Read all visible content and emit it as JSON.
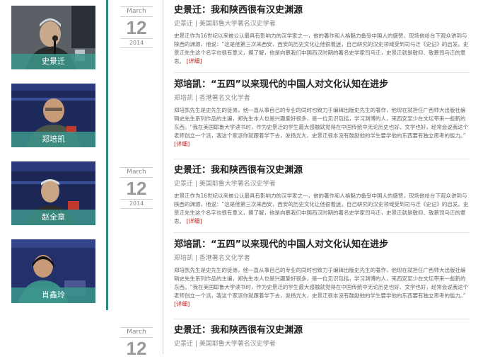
{
  "people": [
    {
      "name": "史景迁"
    },
    {
      "name": "郑培凯"
    },
    {
      "name": "赵全章"
    },
    {
      "name": "肖鑫玲"
    }
  ],
  "dates": [
    {
      "month": "March",
      "day": "12",
      "year": "2014"
    },
    {
      "month": "March",
      "day": "12",
      "year": "2014"
    },
    {
      "month": "March",
      "day": "12"
    }
  ],
  "articles": [
    {
      "title": "史景迁：我和陕西很有汉史渊源",
      "subtitle": "史景迁 | 美国耶鲁大学著名汉史学者",
      "body": "史景迁作为16世纪以来被公认最具有影响力的汉学家之一，他的著作和人格魅力备受中国人的盛赞，现场他给台下观众讲到与陕西的渊源，他说：“这是他第三次来西安，西安的历史文化让他很着迷，自己研究的汉史领域受到司马迁《史记》的启发。史景迁先生这个名字也很有意义，摸了解，他是向慕我们中国西汉时期的著名史学家司马迁，史景迁就是敬仰、敬慕司马迁的意思。",
      "link": "[详细]"
    },
    {
      "title": "郑培凯：“五四”以来现代的中国人对文化认知在进步",
      "subtitle": "郑培凯 | 香港著名文化学者",
      "body": "郑培凯先生是史先生的徒弟，他一直从事自己的专业的同时也致力于编辑出版史先生的著作，他现在就担任广西师大出版社编辑史先生系列作品的主编，郑先生本人也是兴趣爱好很多，是一位见识包括，学习渊博的人，来西安至少在文坛带来一些新的东西。“我在美国耶鲁大学读书时，作为史景迁的学生最大感触就觉得在中国传统中无论历史也好、文学也好，经常会说我这个老师创立一个派，我这个家派你就跟着学下去，发扬光大，史景迁很本没有鼓励他的学生要学他的东西要有独立思考的能力。”",
      "link": "[详细]"
    },
    {
      "title": "史景迁：我和陕西很有汉史渊源",
      "subtitle": "史景迁 | 美国耶鲁大学著名汉史学者",
      "body": "史景迁作为16世纪以来被公认最具有影响力的汉学家之一，他的著作和人格魅力备受中国人的盛赞，现场他给台下观众讲到与陕西的渊源，他说：“这是他第三次来西安，西安的历史文化让他很着迷，自己研究的汉史领域受到司马迁《史记》的启发。史景迁先生这个名字也很有意义，摸了解，他是向慕我们中国西汉时期的著名史学家司马迁，史景迁就是敬仰、敬慕司马迁的意思。",
      "link": "[详细]"
    },
    {
      "title": "郑培凯：“五四”以来现代的中国人对文化认知在进步",
      "subtitle": "郑培凯 | 香港著名文化学者",
      "body": "郑培凯先生是史先生的徒弟，他一直从事自己的专业的同时也致力于编辑出版史先生的著作，他现在就担任广西师大出版社编辑史先生系列作品的主编，郑先生本人也是兴趣爱好很多，是一位见识包括，学习渊博的人，来西安至少在文坛带来一些新的东西。“我在美国耶鲁大学读书时，作为史景迁的学生最大感触就觉得在中国传统中无论历史也好、文学也好，经常会说我这个老师创立一个派，我这个家派你就跟着学下去，发扬光大，史景迁很本没有鼓励他的学生要学他的东西要有独立思考的能力。”",
      "link": "[详细]"
    },
    {
      "title": "史景迁：我和陕西很有汉史渊源",
      "subtitle": "史景迁 | 美国耶鲁大学著名汉史学者",
      "body": "",
      "link": ""
    }
  ],
  "colors": {
    "accent": "#2e8a7e",
    "link": "#b3261e"
  }
}
